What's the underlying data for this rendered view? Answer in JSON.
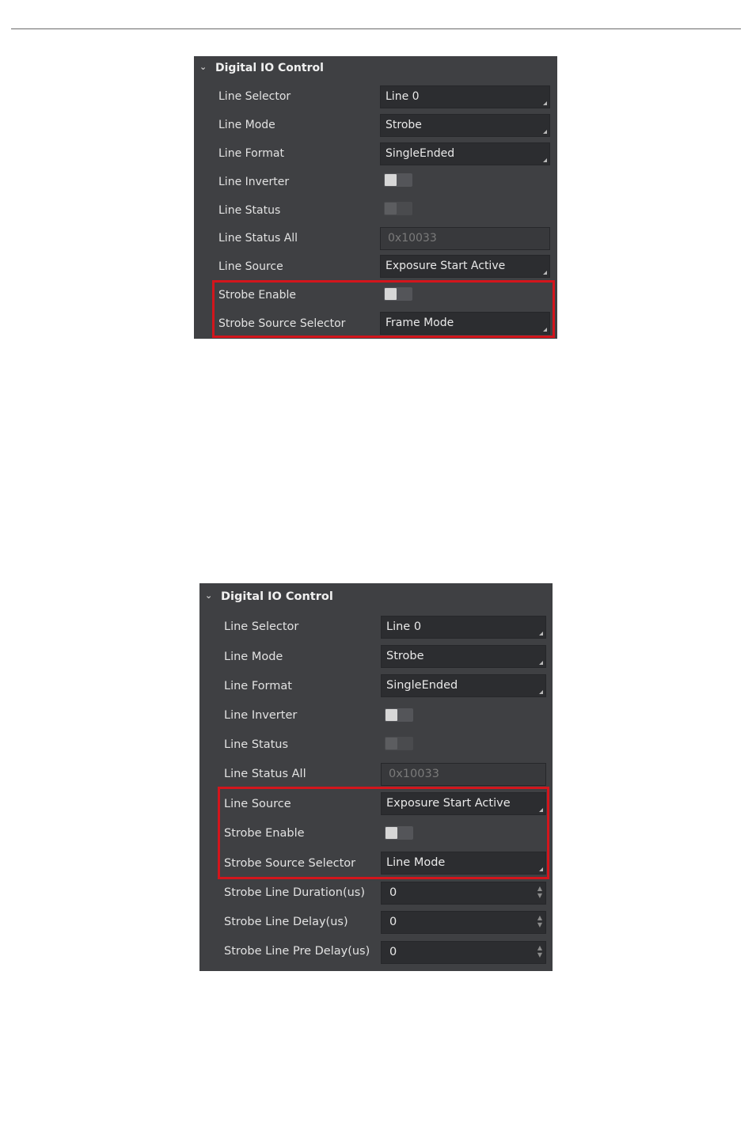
{
  "panel1": {
    "header": "Digital IO Control",
    "rows": [
      {
        "label": "Line Selector",
        "value": "Line 0"
      },
      {
        "label": "Line Mode",
        "value": "Strobe"
      },
      {
        "label": "Line Format",
        "value": "SingleEnded"
      },
      {
        "label": "Line Inverter",
        "toggle": "off"
      },
      {
        "label": "Line Status",
        "toggle": "disabled"
      },
      {
        "label": "Line Status All",
        "value": "0x10033"
      },
      {
        "label": "Line Source",
        "value": "Exposure Start Active"
      },
      {
        "label": "Strobe Enable",
        "toggle": "off"
      },
      {
        "label": "Strobe Source Selector",
        "value": "Frame Mode"
      }
    ]
  },
  "panel2": {
    "header": "Digital IO Control",
    "rows": [
      {
        "label": "Line Selector",
        "value": "Line 0"
      },
      {
        "label": "Line Mode",
        "value": "Strobe"
      },
      {
        "label": "Line Format",
        "value": "SingleEnded"
      },
      {
        "label": "Line Inverter",
        "toggle": "off"
      },
      {
        "label": "Line Status",
        "toggle": "disabled"
      },
      {
        "label": "Line Status All",
        "value": "0x10033"
      },
      {
        "label": "Line Source",
        "value": "Exposure Start Active"
      },
      {
        "label": "Strobe Enable",
        "toggle": "off"
      },
      {
        "label": "Strobe Source Selector",
        "value": "Line Mode"
      },
      {
        "label": "Strobe Line Duration(us)",
        "value": "0"
      },
      {
        "label": "Strobe Line Delay(us)",
        "value": "0"
      },
      {
        "label": "Strobe Line Pre Delay(us)",
        "value": "0"
      }
    ]
  },
  "colors": {
    "panel_bg": "#3f4043",
    "field_bg": "#2c2d30",
    "highlight": "#d3151c"
  }
}
